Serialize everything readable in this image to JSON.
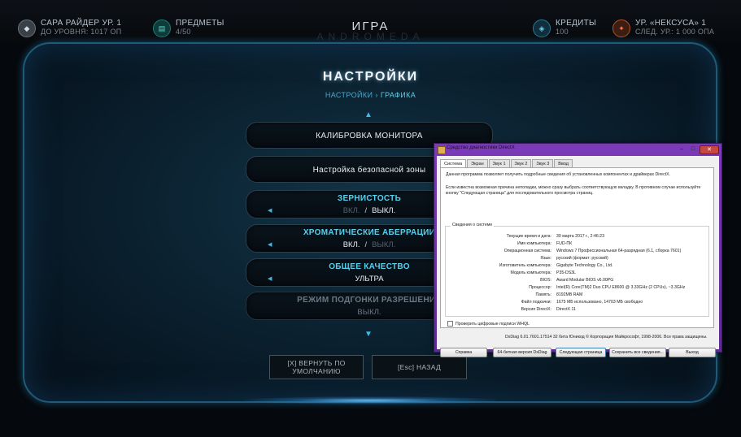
{
  "hud": {
    "player": {
      "line1": "САРА РАЙДЕР УР. 1",
      "line2": "ДО УРОВНЯ: 1017 ОП"
    },
    "items": {
      "line1": "ПРЕДМЕТЫ",
      "line2": "4/50"
    },
    "title": "ИГРА",
    "title_shadow": "ANDROMEDA",
    "credits": {
      "line1": "КРЕДИТЫ",
      "line2": "100"
    },
    "nexus": {
      "line1": "УР. «НЕКСУСА» 1",
      "line2": "СЛЕД. УР.: 1 000 ОПА"
    }
  },
  "settings": {
    "title": "НАСТРОЙКИ",
    "breadcrumb": {
      "root": "НАСТРОЙКИ",
      "sep": "›",
      "current": "ГРАФИКА"
    },
    "up_arrow": "▲",
    "down_arrow": "▼",
    "options": [
      {
        "label": "КАЛИБРОВКА МОНИТОРА"
      },
      {
        "label": "Настройка безопасной зоны"
      },
      {
        "label": "ЗЕРНИСТОСТЬ",
        "on": "ВКЛ.",
        "sep": "/",
        "off": "ВЫКЛ."
      },
      {
        "label": "ХРОМАТИЧЕСКИЕ АБЕРРАЦИИ",
        "on": "ВКЛ.",
        "sep": "/",
        "off": "ВЫКЛ."
      },
      {
        "label": "ОБЩЕЕ КАЧЕСТВО",
        "value": "УЛЬТРА"
      },
      {
        "label": "РЕЖИМ ПОДГОНКИ РАЗРЕШЕНИЯ",
        "value": "ВЫКЛ."
      }
    ],
    "reset_button": "[X] ВЕРНУТЬ ПО УМОЛЧАНИЮ",
    "back_button": "[Esc] НАЗАД"
  },
  "dxdiag": {
    "title": "Средство диагностики DirectX",
    "controls": {
      "min": "–",
      "max": "□",
      "close": "✕"
    },
    "tabs": [
      "Система",
      "Экран",
      "Звук 1",
      "Звук 2",
      "Звук 3",
      "Ввод"
    ],
    "intro1": "Данная программа позволяет получить подробные сведения об установленных компонентах и драйверах DirectX.",
    "intro2": "Если известна возможная причина неполадки, можно сразу выбрать соответствующую вкладку. В противном случае используйте кнопку \"Следующая страница\" для последовательного просмотра страниц.",
    "group_title": "Сведения о системе",
    "rows": [
      {
        "k": "Текущие время и дата:",
        "v": "30 марта 2017 г., 2:46:23"
      },
      {
        "k": "Имя компьютера:",
        "v": "FUD-ПК"
      },
      {
        "k": "Операционная система:",
        "v": "Windows 7 Профессиональная 64-разрядная (6.1, сборка 7601)"
      },
      {
        "k": "Язык:",
        "v": "русский (формат: русский)"
      },
      {
        "k": "Изготовитель компьютера:",
        "v": "Gigabyte Technology Co., Ltd."
      },
      {
        "k": "Модель компьютера:",
        "v": "P35-DS3L"
      },
      {
        "k": "BIOS:",
        "v": "Award Modular BIOS v6.00PG"
      },
      {
        "k": "Процессор:",
        "v": "Intel(R) Core(TM)2 Duo CPU     E8600  @ 3.33GHz (2 CPUs), ~3.3GHz"
      },
      {
        "k": "Память:",
        "v": "8192MB RAM"
      },
      {
        "k": "Файл подкачки:",
        "v": "1675 МБ использовано, 14703 МБ свободно"
      },
      {
        "k": "Версия DirectX:",
        "v": "DirectX 11"
      }
    ],
    "checkbox_label": "Проверить цифровые подписи WHQL",
    "footer": "DxDiag 6.01.7601.17514 32 бита Юникод  © Корпорация Майкрософт, 1998-2006.  Все права защищены.",
    "buttons": {
      "help": "Справка",
      "bit64": "64-битная версия DxDiag",
      "next": "Следующая страница",
      "save": "Сохранить все сведения...",
      "exit": "Выход"
    }
  }
}
